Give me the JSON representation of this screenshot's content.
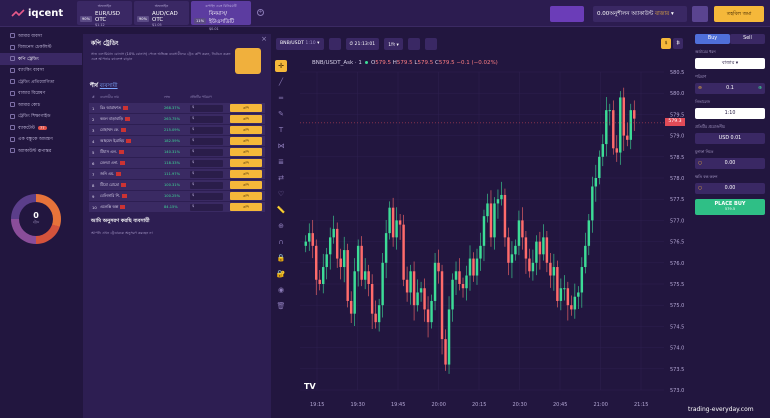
{
  "app": {
    "logo": "iqcent"
  },
  "asset_tabs": [
    {
      "header": "অফলাইন",
      "pct": "90%",
      "name": "EUR/USD OTC",
      "sub": "$1.12"
    },
    {
      "header": "অফলাইন",
      "pct": "90%",
      "name": "AUD/CAD OTC",
      "sub": "$1.05"
    },
    {
      "header": "কপাইং এবং বিনিময়টি",
      "pct": "11%",
      "name": "বিনমাস/ইউএসডিটি",
      "sub": "$0.01"
    }
  ],
  "header": {
    "balance": "0.00অনুশীলন অ্যাকাউন্ট",
    "balance_badge": "বাজার",
    "deposit": "তহবিল জমা"
  },
  "sidebar": {
    "items": [
      {
        "label": "আমার ব্যবসা"
      },
      {
        "label": "বিজনেস চেকলিস্ট"
      },
      {
        "label": "কপি ট্রেডিং",
        "active": true
      },
      {
        "label": "ব্যাংকিং ব্যবসা"
      },
      {
        "label": "ট্রেডিং প্রতিযোগিতা"
      },
      {
        "label": "বাজার বিশ্লেষণ"
      },
      {
        "label": "আমার কোচ"
      },
      {
        "label": "ট্রেডিং শিক্ষাগাইড"
      },
      {
        "label": "ব্যাকটেস্ট",
        "badge": "77"
      },
      {
        "label": "এক বন্ধুকে আমন্ত্রণ"
      },
      {
        "label": "অ্যাকাউন্ট রূপান্তর"
      }
    ],
    "ring_value": "0",
    "ring_label": "ট্রেড"
  },
  "copy_panel": {
    "title": "কপি ট্রেডিং",
    "description": "সাত ডলারিয়ান বোনাস (10% বোনাস) পেতে অভিজ্ঞ ব্যবসায়ীদের ট্রেড কপি করুন, নির্বাচন করুন এবং আপনার ব্যালেন্স বাড়ান",
    "top_title": "শীর্ষ",
    "top_link": "ব্যবসায়ী",
    "col_name": "ব্যবসায়ীর নাম",
    "col_pct": "লাভ",
    "col_amount": "প্রতিটির পরিমাণ",
    "copy_label": "কপি",
    "traders": [
      {
        "n": "1",
        "name": "রিঃ আরাফাত",
        "pct": "268.37%",
        "amount": "$"
      },
      {
        "n": "2",
        "name": "কমল বাড়াবাড়ি",
        "pct": "263.75%",
        "amount": "$"
      },
      {
        "n": "3",
        "name": "মোহাম্মদ কে.",
        "pct": "215.09%",
        "amount": "$"
      },
      {
        "n": "4",
        "name": "আহমেদ ইব্রাহিম",
        "pct": "182.59%",
        "amount": "$"
      },
      {
        "n": "5",
        "name": "টিমাস এল.",
        "pct": "140.31%",
        "amount": "$"
      },
      {
        "n": "6",
        "name": "মেলবা এনা.",
        "pct": "118.33%",
        "amount": "$"
      },
      {
        "n": "7",
        "name": "জনি এম.",
        "pct": "111.97%",
        "amount": "$"
      },
      {
        "n": "8",
        "name": "টিমো রোদ্রো",
        "pct": "100.31%",
        "amount": "$"
      },
      {
        "n": "9",
        "name": "বেলিসারি শি.",
        "pct": "100.25%",
        "amount": "$"
      },
      {
        "n": "10",
        "name": "এলেক্সি অল্প",
        "pct": "84.15%",
        "amount": "$"
      }
    ],
    "question": "আমি অনুসরণ করছি ব্যবসায়ী",
    "answer": "আপনি এখন ট্রেডারকে অনুসরণ করছেন না"
  },
  "chart_toolbar": {
    "pair": "BNB/USDT",
    "pair_mult": "1:10",
    "time": "21:13:01",
    "period": "1মি",
    "dd1": "$",
    "dd2": "₿"
  },
  "ohlc": {
    "title": "BNB/USDT_Ask · 1",
    "o_label": "O",
    "o": "579.5",
    "h_label": "H",
    "h": "579.5",
    "l_label": "L",
    "l": "579.5",
    "c_label": "C",
    "c": "579.5",
    "chg": "−0.1 (−0.02%)"
  },
  "current_price": "579.3",
  "chart_data": {
    "type": "candlestick",
    "x_ticks": [
      "19:15",
      "19:30",
      "19:45",
      "20:00",
      "20:15",
      "20:30",
      "20:45",
      "21:00",
      "21:15"
    ],
    "y_ticks": [
      "580.5",
      "580.0",
      "579.5",
      "579.0",
      "578.5",
      "578.0",
      "577.5",
      "577.0",
      "576.5",
      "576.0",
      "575.5",
      "575.0",
      "574.5",
      "574.0",
      "573.5",
      "573.0"
    ],
    "ylim": [
      573.0,
      580.5
    ],
    "close_path": [
      576.5,
      576.7,
      576.4,
      575.6,
      575.5,
      575.9,
      576.2,
      576.6,
      576.8,
      576.1,
      575.9,
      576.3,
      575.1,
      574.8,
      575.8,
      576.4,
      575.6,
      575.8,
      575.5,
      574.8,
      574.6,
      575.0,
      576.0,
      576.7,
      577.3,
      576.6,
      577.0,
      576.9,
      575.6,
      575.3,
      575.8,
      575.0,
      575.3,
      575.4,
      574.9,
      574.6,
      575.1,
      576.0,
      575.8,
      574.2,
      573.6,
      574.9,
      575.6,
      575.8,
      575.5,
      575.4,
      575.7,
      576.1,
      575.7,
      576.1,
      576.4,
      577.1,
      577.4,
      576.6,
      577.4,
      577.5,
      577.6,
      576.6,
      576.0,
      576.2,
      576.4,
      577.0,
      576.6,
      576.1,
      575.8,
      576.0,
      576.5,
      576.2,
      576.6,
      576.0,
      575.7,
      575.9,
      575.1,
      575.4,
      575.4,
      575.0,
      574.9,
      575.2,
      575.3,
      575.9,
      576.4,
      577.0,
      577.8,
      578.0,
      578.5,
      578.8,
      579.6,
      579.6,
      578.7,
      578.6,
      579.9,
      579.0,
      578.9,
      579.6,
      579.4
    ]
  },
  "trade": {
    "buy": "Buy",
    "sell": "Sell",
    "order_type_label": "অর্ডারের ধরন",
    "order_type": "বাজার",
    "amount_label": "পরিমাণ",
    "amount": "0.1",
    "multiplier_label": "লিভারেজ",
    "multiplier": "1:10",
    "margin_label": "প্রতিটির প্রয়োজনীয়",
    "margin": "USD 0.01",
    "tp_label": "মুনাফা নিতে",
    "tp": "0.00",
    "sl_label": "ক্ষতি বন্ধ করুন",
    "sl": "0.00",
    "place": "PLACE BUY",
    "place_price": "579.5"
  },
  "watermark": "trading-everyday.com"
}
